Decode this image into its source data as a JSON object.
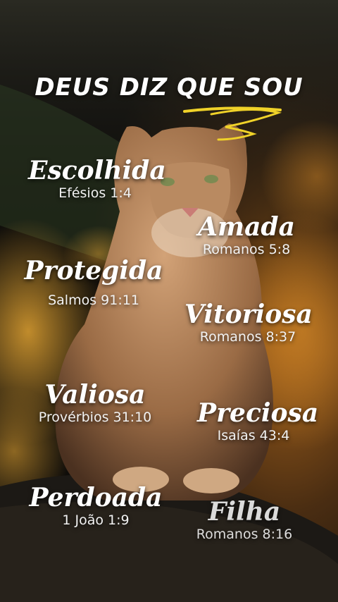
{
  "title": "DEUS DIZ QUE SOU",
  "accent_color": "#f0d229",
  "items": [
    {
      "word": "Escolhida",
      "ref": "Efésios 1:4"
    },
    {
      "word": "Amada",
      "ref": "Romanos 5:8"
    },
    {
      "word": "Protegida",
      "ref": "Salmos 91:11"
    },
    {
      "word": "Vitoriosa",
      "ref": "Romanos 8:37"
    },
    {
      "word": "Valiosa",
      "ref": "Provérbios 31:10"
    },
    {
      "word": "Preciosa",
      "ref": "Isaías 43:4"
    },
    {
      "word": "Perdoada",
      "ref": "1 João 1:9"
    },
    {
      "word": "Filha",
      "ref": "Romanos 8:16"
    }
  ]
}
